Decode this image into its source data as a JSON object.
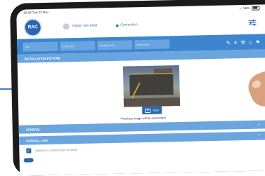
{
  "status": {
    "time": "10:09",
    "date": "Tue 22 Nov",
    "wifi": "wifi-icon",
    "battery_text": "66%"
  },
  "brand": {
    "logo_text": "RAC"
  },
  "header": {
    "user_name": "Glatter Van Aebil",
    "connection_label": "Connection"
  },
  "toolbar": {
    "fields": [
      "Site",
      "Customer",
      "Cooling Unit",
      "Reference"
    ],
    "icons": [
      "edit-icon",
      "list-icon",
      "tools-icon",
      "home-icon",
      "flag-icon"
    ]
  },
  "sections": {
    "installation_picture": "INSTALLATION PICTURE",
    "general": "GENERAL",
    "overall_unit": "OVERALL UNIT"
  },
  "photo": {
    "add_label": "ADD",
    "note": "*Previous image will be overwritten"
  },
  "overall_unit_row": {
    "label": "Material / Construction material",
    "checked": true
  }
}
